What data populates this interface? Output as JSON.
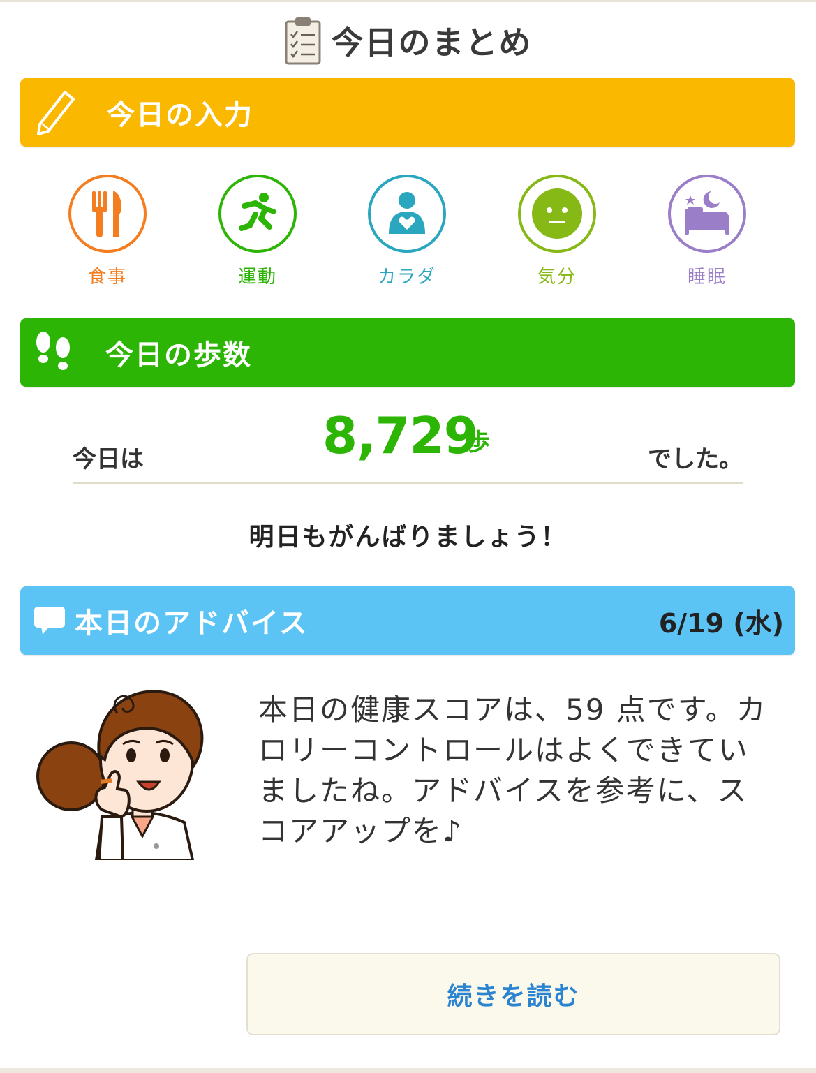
{
  "header": {
    "title": "今日のまとめ",
    "icon": "clipboard-checklist-icon"
  },
  "today_input": {
    "title": "今日の入力",
    "icon": "pencil-icon",
    "color": "#fbb800",
    "categories": [
      {
        "label": "食事",
        "icon": "fork-knife-icon",
        "color": "#f47d20"
      },
      {
        "label": "運動",
        "icon": "running-person-icon",
        "color": "#2cb505"
      },
      {
        "label": "カラダ",
        "icon": "person-heart-icon",
        "color": "#2aa6bf"
      },
      {
        "label": "気分",
        "icon": "face-icon",
        "color": "#86b816"
      },
      {
        "label": "睡眠",
        "icon": "bed-moon-icon",
        "color": "#9b7ec8"
      }
    ]
  },
  "steps": {
    "title": "今日の歩数",
    "icon": "footprints-icon",
    "color": "#2cb505",
    "prefix": "今日は",
    "value": "8,729",
    "unit": "歩",
    "suffix": "でした。",
    "encouragement": "明日もがんばりましょう！"
  },
  "advice": {
    "title": "本日のアドバイス",
    "icon": "speech-bubble-icon",
    "color": "#5bc4f5",
    "date": "6/19 (水)",
    "text": "本日の健康スコアは、59 点です。カロリーコントロールはよくできていましたね。アドバイスを参考に、スコアアップを♪",
    "read_more": "続きを読む"
  }
}
